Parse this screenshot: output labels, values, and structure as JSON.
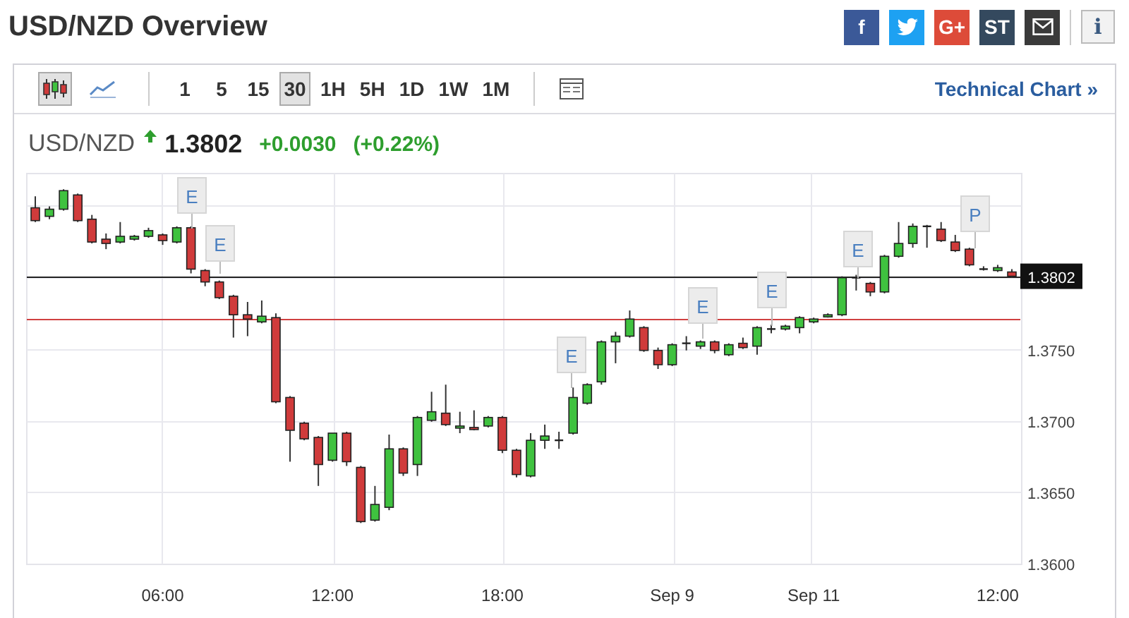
{
  "title": "USD/NZD Overview",
  "share_buttons": [
    {
      "kind": "facebook",
      "label": "f"
    },
    {
      "kind": "twitter"
    },
    {
      "kind": "googleplus",
      "label": "G+"
    },
    {
      "kind": "stocktwits",
      "label": "ST"
    },
    {
      "kind": "email"
    }
  ],
  "info_button": {
    "label": "i"
  },
  "toolbar": {
    "chart_types": [
      {
        "kind": "candles",
        "selected": true
      },
      {
        "kind": "line",
        "selected": false
      }
    ],
    "timeframes": [
      {
        "label": "1",
        "selected": false
      },
      {
        "label": "5",
        "selected": false
      },
      {
        "label": "15",
        "selected": false
      },
      {
        "label": "30",
        "selected": true
      },
      {
        "label": "1H",
        "selected": false
      },
      {
        "label": "5H",
        "selected": false
      },
      {
        "label": "1D",
        "selected": false
      },
      {
        "label": "1W",
        "selected": false
      },
      {
        "label": "1M",
        "selected": false
      }
    ],
    "technical_chart_link": "Technical Chart »"
  },
  "quote": {
    "symbol": "USD/NZD",
    "change_up": true,
    "price": "1.3802",
    "change": "+0.0030",
    "change_percent": "(+0.22%)"
  },
  "chart": {
    "events": [
      {
        "label": "E"
      },
      {
        "label": "E"
      },
      {
        "label": "E"
      },
      {
        "label": "E"
      },
      {
        "label": "E"
      },
      {
        "label": "E"
      },
      {
        "label": "P"
      }
    ],
    "current_price": "1.3802",
    "chart_data": {
      "type": "candlestick",
      "categories": [
        null,
        null,
        null,
        null,
        null,
        null,
        null,
        null,
        null,
        "06:00",
        null,
        null,
        null,
        null,
        null,
        null,
        null,
        null,
        null,
        null,
        null,
        "12:00",
        null,
        null,
        null,
        null,
        null,
        null,
        null,
        null,
        null,
        null,
        null,
        "18:00",
        null,
        null,
        null,
        null,
        null,
        null,
        null,
        null,
        null,
        null,
        null,
        "Sep 9",
        null,
        null,
        null,
        null,
        null,
        null,
        null,
        null,
        null,
        "Sep 11",
        null,
        null,
        null,
        null,
        null,
        null,
        null,
        null,
        null,
        null,
        null,
        null,
        "12:00",
        null
      ],
      "ohlc": [
        [
          1.385,
          1.3858,
          1.384,
          1.3841
        ],
        [
          1.3844,
          1.3851,
          1.3842,
          1.3849
        ],
        [
          1.3849,
          1.3863,
          1.3848,
          1.3862
        ],
        [
          1.3859,
          1.386,
          1.384,
          1.3841
        ],
        [
          1.3842,
          1.3845,
          1.3825,
          1.3826
        ],
        [
          1.3828,
          1.3832,
          1.3821,
          1.3825
        ],
        [
          1.3826,
          1.384,
          1.3825,
          1.383
        ],
        [
          1.3828,
          1.3831,
          1.3827,
          1.383
        ],
        [
          1.383,
          1.3836,
          1.3829,
          1.3834
        ],
        [
          1.3831,
          1.3832,
          1.3824,
          1.3827
        ],
        [
          1.3826,
          1.3837,
          1.3825,
          1.3836
        ],
        [
          1.3836,
          1.3837,
          1.3804,
          1.3807
        ],
        [
          1.3806,
          1.3807,
          1.3795,
          1.3798
        ],
        [
          1.3798,
          1.3799,
          1.3786,
          1.3787
        ],
        [
          1.3788,
          1.3789,
          1.3759,
          1.3775
        ],
        [
          1.3775,
          1.3784,
          1.376,
          1.3772
        ],
        [
          1.377,
          1.3785,
          1.3769,
          1.3774
        ],
        [
          1.3773,
          1.3776,
          1.3713,
          1.3714
        ],
        [
          1.3717,
          1.3718,
          1.3672,
          1.3694
        ],
        [
          1.3699,
          1.37,
          1.3687,
          1.3688
        ],
        [
          1.3689,
          1.369,
          1.3655,
          1.367
        ],
        [
          1.3673,
          1.3692,
          1.3672,
          1.3692
        ],
        [
          1.3692,
          1.3693,
          1.3669,
          1.3672
        ],
        [
          1.3668,
          1.3669,
          1.3629,
          1.363
        ],
        [
          1.3631,
          1.3655,
          1.363,
          1.3642
        ],
        [
          1.364,
          1.3691,
          1.3638,
          1.3681
        ],
        [
          1.3681,
          1.3682,
          1.3662,
          1.3664
        ],
        [
          1.367,
          1.3704,
          1.3662,
          1.3703
        ],
        [
          1.3701,
          1.3721,
          1.37,
          1.3707
        ],
        [
          1.3706,
          1.3726,
          1.3697,
          1.3698
        ],
        [
          1.3696,
          1.3707,
          1.3692,
          1.3697
        ],
        [
          1.3696,
          1.3708,
          1.3694,
          1.3695
        ],
        [
          1.3697,
          1.3704,
          1.3696,
          1.3703
        ],
        [
          1.3703,
          1.3704,
          1.3678,
          1.368
        ],
        [
          1.368,
          1.3681,
          1.3661,
          1.3663
        ],
        [
          1.3662,
          1.3692,
          1.3661,
          1.3687
        ],
        [
          1.3687,
          1.3698,
          1.3681,
          1.369
        ],
        [
          1.3687,
          1.3693,
          1.3681,
          1.3687
        ],
        [
          1.3692,
          1.3724,
          1.3691,
          1.3717
        ],
        [
          1.3713,
          1.3727,
          1.3712,
          1.3726
        ],
        [
          1.3728,
          1.3757,
          1.3726,
          1.3756
        ],
        [
          1.3756,
          1.3763,
          1.3741,
          1.376
        ],
        [
          1.376,
          1.3778,
          1.3759,
          1.3772
        ],
        [
          1.3766,
          1.3767,
          1.3749,
          1.375
        ],
        [
          1.375,
          1.3752,
          1.3737,
          1.374
        ],
        [
          1.374,
          1.3755,
          1.3739,
          1.3754
        ],
        [
          1.3755,
          1.376,
          1.375,
          1.3755
        ],
        [
          1.3753,
          1.3757,
          1.3751,
          1.3756
        ],
        [
          1.3756,
          1.3757,
          1.3748,
          1.375
        ],
        [
          1.3747,
          1.3755,
          1.3746,
          1.3754
        ],
        [
          1.3755,
          1.3759,
          1.3751,
          1.3752
        ],
        [
          1.3753,
          1.3767,
          1.3747,
          1.3766
        ],
        [
          1.3765,
          1.3768,
          1.3762,
          1.3765
        ],
        [
          1.3765,
          1.3768,
          1.3764,
          1.3767
        ],
        [
          1.3766,
          1.3774,
          1.3762,
          1.3773
        ],
        [
          1.377,
          1.3773,
          1.3769,
          1.3772
        ],
        [
          1.3774,
          1.3776,
          1.3773,
          1.3775
        ],
        [
          1.3775,
          1.3802,
          1.3774,
          1.3801
        ],
        [
          1.3801,
          1.3803,
          1.3792,
          1.3801
        ],
        [
          1.3797,
          1.3798,
          1.3788,
          1.3791
        ],
        [
          1.3791,
          1.3817,
          1.379,
          1.3816
        ],
        [
          1.3816,
          1.384,
          1.3815,
          1.3825
        ],
        [
          1.3825,
          1.3839,
          1.3822,
          1.3837
        ],
        [
          1.3837,
          1.3838,
          1.3822,
          1.3837
        ],
        [
          1.3835,
          1.384,
          1.3826,
          1.3827
        ],
        [
          1.3826,
          1.3831,
          1.3819,
          1.382
        ],
        [
          1.3821,
          1.3822,
          1.3809,
          1.381
        ],
        [
          1.3807,
          1.3809,
          1.3806,
          1.3807
        ],
        [
          1.3806,
          1.381,
          1.3805,
          1.3808
        ],
        [
          1.3805,
          1.3807,
          1.3801,
          1.3802
        ]
      ],
      "ylim": [
        1.36,
        1.3874
      ],
      "grid": true,
      "ref_lines": [
        {
          "axis": "y",
          "value": 1.3802,
          "color": "#222222"
        },
        {
          "axis": "y",
          "value": 1.3772,
          "color": "#d04040"
        }
      ],
      "yticks": [
        {
          "value": 1.375,
          "label": "1.3750"
        },
        {
          "value": 1.37,
          "label": "1.3700"
        },
        {
          "value": 1.365,
          "label": "1.3650"
        },
        {
          "value": 1.36,
          "label": "1.3600"
        }
      ]
    }
  }
}
